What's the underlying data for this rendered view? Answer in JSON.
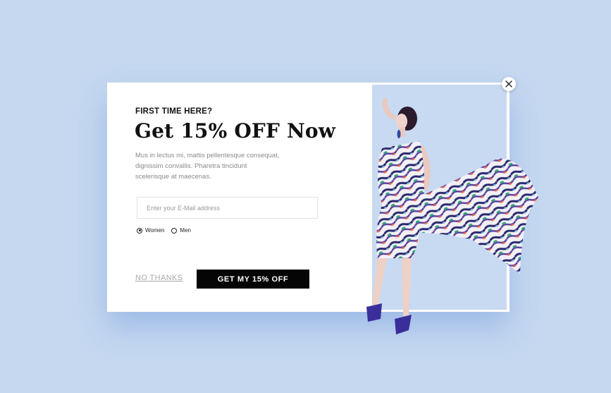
{
  "popup": {
    "eyebrow": "FIRST TIME HERE?",
    "title": "Get 15% OFF Now",
    "body": "Mus in lectus mi, mattis pellentesque consequat, dignissim convallis. Pharetra tincidunt scelerisque at maecenas.",
    "email_placeholder": "Enter your E-Mail address",
    "gender_options": [
      {
        "label": "Women",
        "checked": true
      },
      {
        "label": "Men",
        "checked": false
      }
    ],
    "decline_label": "NO THANKS",
    "cta_label": "GET MY 15% OFF",
    "close_icon": "close-icon",
    "image": "fashion-model-in-patterned-dress"
  },
  "colors": {
    "background": "#c5d8f0",
    "panel": "#c8daf2",
    "cta": "#050505"
  }
}
